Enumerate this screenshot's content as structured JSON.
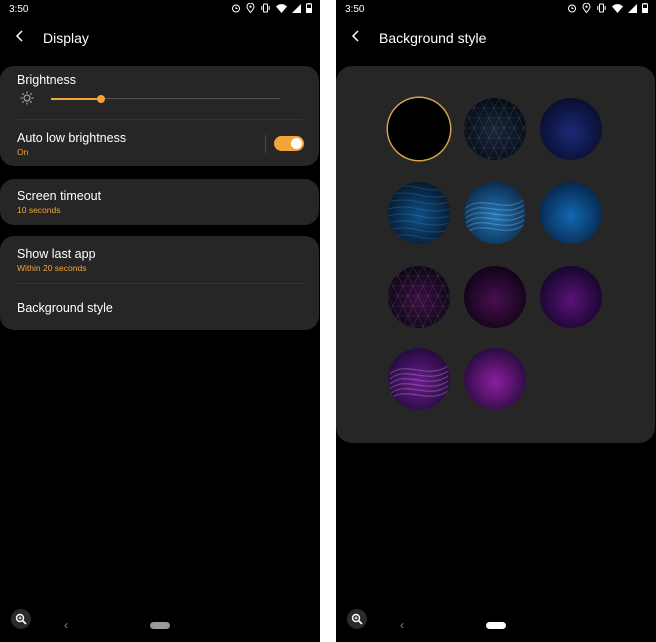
{
  "left_screen": {
    "status_bar": {
      "time": "3:50",
      "icons": [
        "alarm-icon",
        "location-icon",
        "vibrate-icon",
        "wifi-icon",
        "signal-icon",
        "battery-icon"
      ]
    },
    "app_bar": {
      "title": "Display",
      "back_icon": "back-arrow-icon"
    },
    "brightness": {
      "label": "Brightness",
      "icon": "brightness-icon",
      "level_fraction": 0.22
    },
    "auto_low_brightness": {
      "label": "Auto low brightness",
      "status": "On",
      "enabled": true
    },
    "screen_timeout": {
      "label": "Screen timeout",
      "value": "10 seconds"
    },
    "show_last_app": {
      "label": "Show last app",
      "value": "Within 20 seconds"
    },
    "background_style": {
      "label": "Background style"
    },
    "nav": {
      "back": "‹",
      "zoom_icon": "magnifier-icon"
    }
  },
  "right_screen": {
    "status_bar": {
      "time": "3:50",
      "icons": [
        "alarm-icon",
        "location-icon",
        "vibrate-icon",
        "wifi-icon",
        "signal-icon",
        "battery-icon"
      ]
    },
    "app_bar": {
      "title": "Background style",
      "back_icon": "back-arrow-icon"
    },
    "selected_index": 0,
    "styles": [
      {
        "name": "black",
        "base": "#000000",
        "glow": "#000000",
        "pattern": "none"
      },
      {
        "name": "dark-triangles",
        "base": "#050a14",
        "glow": "#18273c",
        "pattern": "triangles"
      },
      {
        "name": "navy",
        "base": "#080c2a",
        "glow": "#1b2a78",
        "pattern": "none"
      },
      {
        "name": "blue-wave",
        "base": "#06172c",
        "glow": "#0e4f86",
        "pattern": "waves"
      },
      {
        "name": "blue-ribbon",
        "base": "#0a2a4a",
        "glow": "#2076b8",
        "pattern": "ribbon"
      },
      {
        "name": "blue",
        "base": "#062448",
        "glow": "#1268b2",
        "pattern": "none"
      },
      {
        "name": "magenta-triangles",
        "base": "#0b0612",
        "glow": "#3a0f44",
        "pattern": "triangles"
      },
      {
        "name": "dark-magenta",
        "base": "#0c0314",
        "glow": "#470f50",
        "pattern": "none"
      },
      {
        "name": "purple",
        "base": "#12052a",
        "glow": "#5b1277",
        "pattern": "none"
      },
      {
        "name": "purple-ribbon",
        "base": "#220a3a",
        "glow": "#6a1b8e",
        "pattern": "ribbon"
      },
      {
        "name": "magenta",
        "base": "#240a3a",
        "glow": "#8c1ea0",
        "pattern": "none"
      }
    ],
    "nav": {
      "back": "‹",
      "zoom_icon": "magnifier-icon"
    }
  },
  "colors": {
    "accent": "#f3a43a",
    "card": "#262626",
    "background": "#000000"
  }
}
